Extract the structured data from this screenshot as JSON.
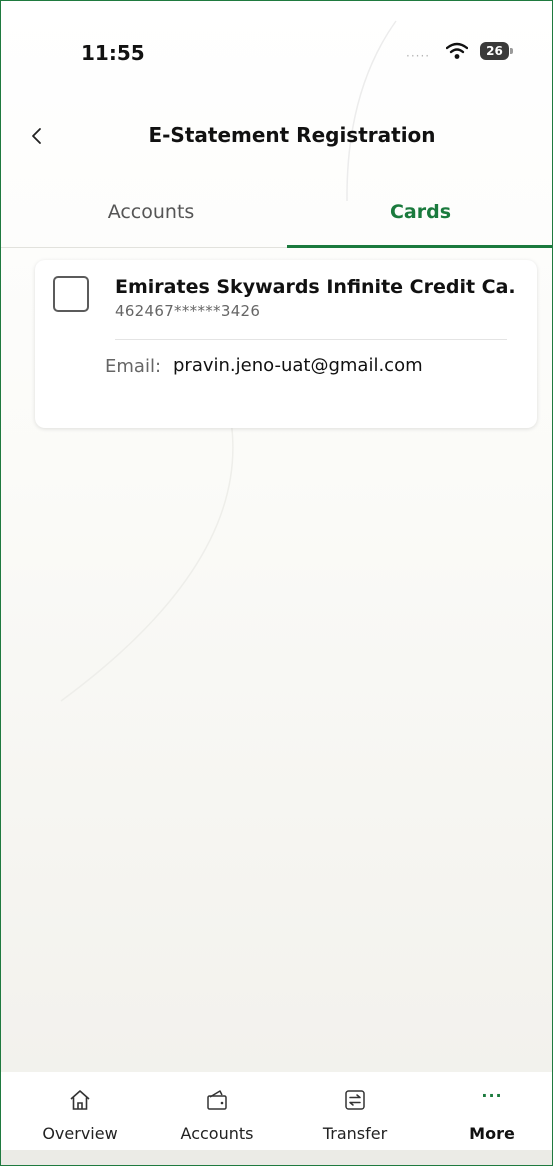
{
  "status_bar": {
    "time": "11:55",
    "signal": "·····",
    "battery": "26"
  },
  "header": {
    "title": "E-Statement Registration"
  },
  "tabs": [
    {
      "label": "Accounts",
      "active": false
    },
    {
      "label": "Cards",
      "active": true
    }
  ],
  "cards": [
    {
      "name": "Emirates Skywards Infinite Credit Ca...",
      "number": "462467******3426",
      "email_label": "Email:",
      "email": "pravin.jeno-uat@gmail.com",
      "checked": false
    }
  ],
  "bottom_nav": [
    {
      "label": "Overview",
      "icon": "home-icon"
    },
    {
      "label": "Accounts",
      "icon": "wallet-icon"
    },
    {
      "label": "Transfer",
      "icon": "transfer-icon"
    },
    {
      "label": "More",
      "icon": "more-dots-icon",
      "glyph": "···",
      "active": true
    }
  ],
  "colors": {
    "accent": "#1a7a3d",
    "text": "#111111",
    "muted": "#666666"
  }
}
